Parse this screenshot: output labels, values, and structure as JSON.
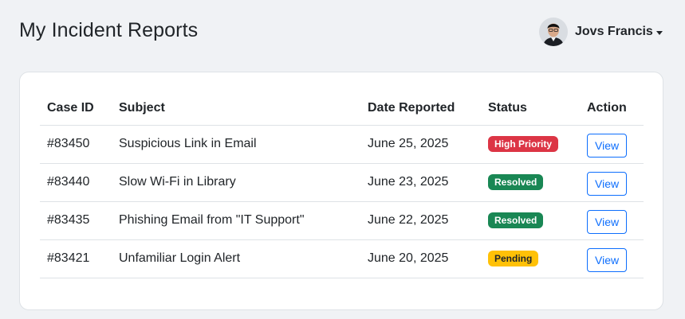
{
  "header": {
    "title": "My Incident Reports",
    "user": {
      "name": "Jovs Francis",
      "avatar_icon": "user-avatar"
    }
  },
  "table": {
    "columns": [
      "Case ID",
      "Subject",
      "Date Reported",
      "Status",
      "Action"
    ],
    "rows": [
      {
        "case_id": "#83450",
        "subject": "Suspicious Link in Email",
        "date": "June 25, 2025",
        "status": "High Priority",
        "status_color": "#dc3545",
        "action": "View"
      },
      {
        "case_id": "#83440",
        "subject": "Slow Wi-Fi in Library",
        "date": "June 23, 2025",
        "status": "Resolved",
        "status_color": "#198754",
        "action": "View"
      },
      {
        "case_id": "#83435",
        "subject": "Phishing Email from \"IT Support\"",
        "date": "June 22, 2025",
        "status": "Resolved",
        "status_color": "#198754",
        "action": "View"
      },
      {
        "case_id": "#83421",
        "subject": "Unfamiliar Login Alert",
        "date": "June 20, 2025",
        "status": "Pending",
        "status_color": "#ffc107",
        "action": "View"
      }
    ]
  },
  "colors": {
    "page_bg": "#f0f2f5",
    "accent": "#0d6efd"
  }
}
